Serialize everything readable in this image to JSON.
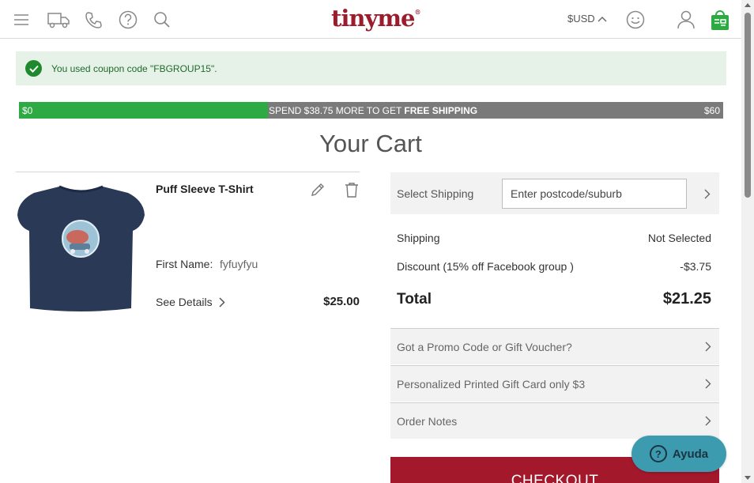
{
  "header": {
    "logo": "tinyme",
    "logo_mark": "®",
    "currency": "$USD",
    "icons": [
      "menu-icon",
      "truck-icon",
      "phone-icon",
      "help-icon",
      "search-icon",
      "smiley-icon",
      "user-icon",
      "cart-icon"
    ]
  },
  "coupon": {
    "message": "You used coupon code \"FBGROUP15\"."
  },
  "shipping_progress": {
    "min_label": "$0",
    "max_label": "$60",
    "message_prefix": "SPEND $38.75 MORE TO GET ",
    "message_bold": "FREE SHIPPING",
    "fraction": 0.354,
    "fill_color": "#2daa44",
    "track_color": "#7a7a7a"
  },
  "cart": {
    "title": "Your Cart",
    "item": {
      "name": "Puff Sleeve T-Shirt",
      "first_name_label": "First Name:",
      "first_name_value": "fyfuyfyu",
      "see_details": "See Details",
      "price": "$25.00"
    }
  },
  "summary": {
    "select_shipping_label": "Select Shipping",
    "postcode_placeholder": "Enter postcode/suburb",
    "shipping_label": "Shipping",
    "shipping_value": "Not Selected",
    "discount_label": "Discount (15% off Facebook group )",
    "discount_value": "-$3.75",
    "total_label": "Total",
    "total_value": "$21.25",
    "promo_label": "Got a Promo Code or Gift Voucher?",
    "gift_card_label": "Personalized Printed Gift Card only $3",
    "order_notes_label": "Order Notes",
    "checkout_label": "CHECKOUT"
  },
  "help_widget": {
    "label": "Ayuda"
  },
  "colors": {
    "brand": "#9b1c2c",
    "checkout": "#a3182b",
    "success": "#1e8a2d",
    "help": "#3d9bb0"
  }
}
